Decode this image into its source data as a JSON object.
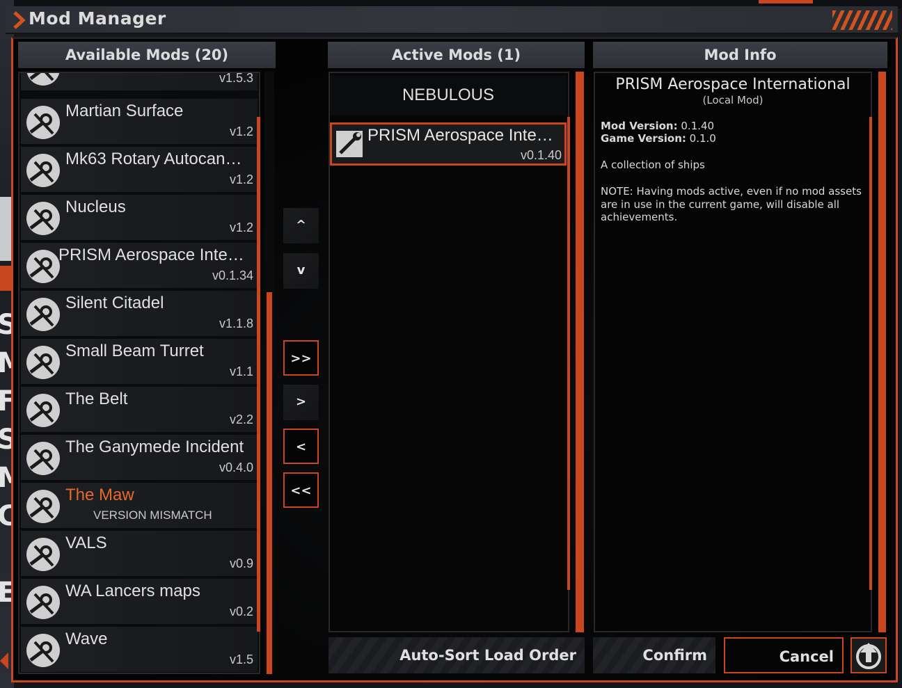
{
  "window": {
    "title": "Mod Manager"
  },
  "background": {
    "side_letters": [
      "S",
      "M",
      "F",
      "S",
      "M",
      "C",
      "",
      "E"
    ]
  },
  "available": {
    "header": "Available Mods (20)",
    "mods": [
      {
        "name": "",
        "version": "v1.5.3"
      },
      {
        "name": "Martian Surface",
        "version": "v1.2"
      },
      {
        "name": "Mk63 Rotary Autocan…",
        "version": "v1.2"
      },
      {
        "name": "Nucleus",
        "version": "v1.2"
      },
      {
        "name": "PRISM Aerospace Inte…",
        "version": "v0.1.34"
      },
      {
        "name": "Silent Citadel",
        "version": "v1.1.8"
      },
      {
        "name": "Small Beam Turret",
        "version": "v1.1"
      },
      {
        "name": "The Belt",
        "version": "v2.2"
      },
      {
        "name": "The Ganymede Incident",
        "version": "v0.4.0"
      },
      {
        "name": "The Maw",
        "version": "",
        "warning": "VERSION MISMATCH"
      },
      {
        "name": "VALS",
        "version": "v0.9"
      },
      {
        "name": "WA Lancers maps",
        "version": "v0.2"
      },
      {
        "name": "Wave",
        "version": "v1.5"
      }
    ]
  },
  "transfer": {
    "up": "^",
    "down": "v",
    "add_all": ">>",
    "add": ">",
    "remove": "<",
    "remove_all": "<<"
  },
  "active": {
    "header": "Active Mods (1)",
    "group": "NEBULOUS",
    "items": [
      {
        "name": "PRISM Aerospace Inte…",
        "version": "v0.1.40"
      }
    ]
  },
  "info": {
    "header": "Mod Info",
    "title": "PRISM Aerospace International",
    "subtitle": "(Local Mod)",
    "mod_version_label": "Mod Version:",
    "mod_version": "0.1.40",
    "game_version_label": "Game Version:",
    "game_version": "0.1.0",
    "description": "A collection of ships",
    "note_line1": "NOTE: Having mods active, even if no mod assets",
    "note_line2": "are in use in the current game, will disable all",
    "note_line3": "achievements."
  },
  "buttons": {
    "auto_sort": "Auto-Sort Load Order",
    "confirm": "Confirm",
    "cancel": "Cancel"
  },
  "colors": {
    "accent": "#c9461e",
    "warning_text": "#e46a2a"
  }
}
